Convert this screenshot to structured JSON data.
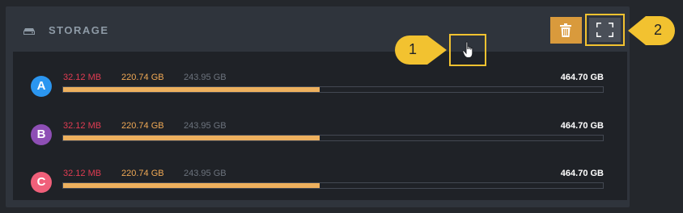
{
  "panel": {
    "title": "STORAGE",
    "icon": "hard-drive-icon"
  },
  "toolbar": {
    "delete_icon": "trash-icon",
    "fullscreen_icon": "fullscreen-icon"
  },
  "drives": [
    {
      "letter": "A",
      "color": "#2b96f0",
      "used": "32.12 MB",
      "free": "220.74 GB",
      "available": "243.95 GB",
      "total": "464.70 GB",
      "fill_fraction": 0.475
    },
    {
      "letter": "B",
      "color": "#8e4fb5",
      "used": "32.12 MB",
      "free": "220.74 GB",
      "available": "243.95 GB",
      "total": "464.70 GB",
      "fill_fraction": 0.475
    },
    {
      "letter": "C",
      "color": "#f0607a",
      "used": "32.12 MB",
      "free": "220.74 GB",
      "available": "243.95 GB",
      "total": "464.70 GB",
      "fill_fraction": 0.475
    }
  ],
  "callouts": [
    {
      "number": "1"
    },
    {
      "number": "2"
    }
  ],
  "colors": {
    "accent": "#f2c230",
    "bar_fill": "#edb05e",
    "used_text": "#e03c52",
    "free_text": "#f0a955"
  }
}
